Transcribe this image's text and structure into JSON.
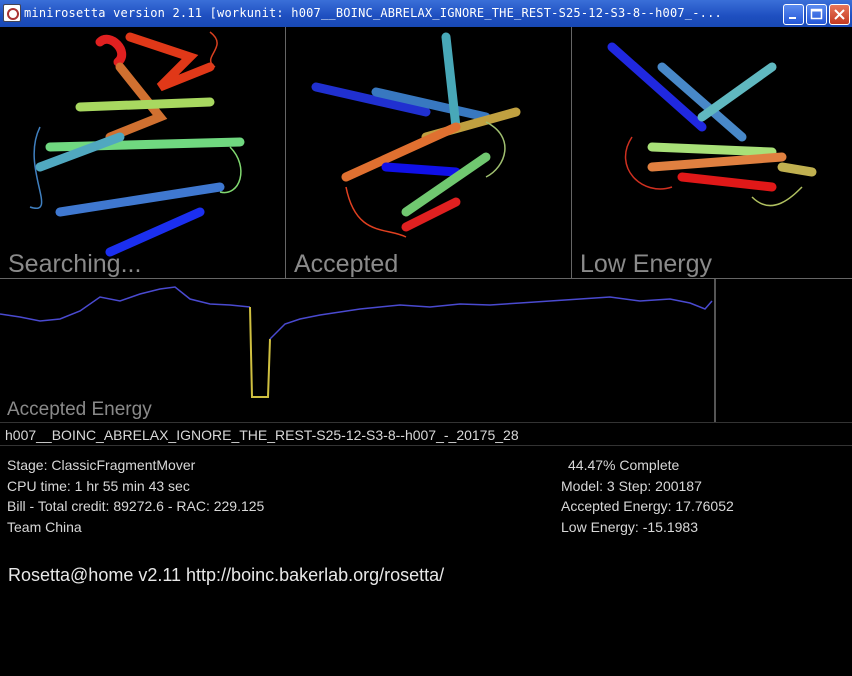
{
  "window": {
    "title": "minirosetta version 2.11 [workunit: h007__BOINC_ABRELAX_IGNORE_THE_REST-S25-12-S3-8--h007_-..."
  },
  "panels": [
    {
      "label": "Searching..."
    },
    {
      "label": "Accepted"
    },
    {
      "label": "Low Energy"
    }
  ],
  "energy_panel": {
    "label": "Accepted Energy"
  },
  "workunit_name": "h007__BOINC_ABRELAX_IGNORE_THE_REST-S25-12-S3-8--h007_-_20175_28",
  "status": {
    "stage": "Stage: ClassicFragmentMover",
    "cpu_time": "CPU time: 1 hr 55 min 43 sec",
    "credit": "Bill - Total credit: 89272.6 - RAC: 229.125",
    "team": "Team China",
    "complete": "44.47% Complete",
    "model_step": "Model: 3  Step: 200187",
    "accepted_energy": "Accepted Energy: 17.76052",
    "low_energy": "Low Energy: -15.1983"
  },
  "footer": "Rosetta@home v2.11 http://boinc.bakerlab.org/rosetta/",
  "colors": {
    "titlebar": "#1e4fc0",
    "energy_line": "#4a4ad0",
    "energy_spike": "#d0c040",
    "text": "#d8d8d8"
  },
  "icons": [
    "app-icon",
    "minimize-icon",
    "maximize-icon",
    "close-icon"
  ]
}
